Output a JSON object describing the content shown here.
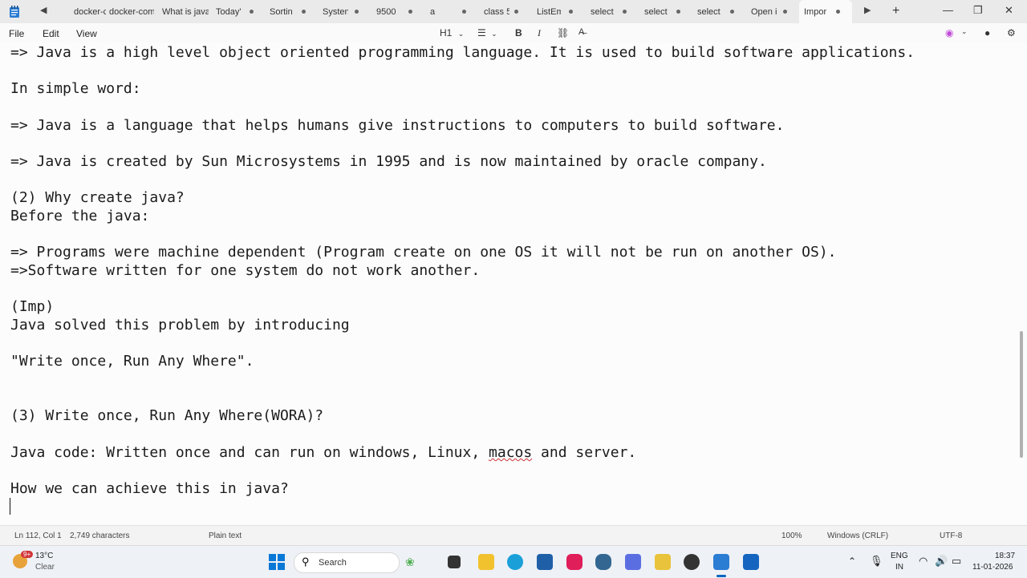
{
  "tabs": [
    {
      "label": "docker-com"
    },
    {
      "label": "docker-com"
    },
    {
      "label": "What is java"
    },
    {
      "label": "Today'"
    },
    {
      "label": "Sortin"
    },
    {
      "label": "Systen"
    },
    {
      "label": "9500"
    },
    {
      "label": "a"
    },
    {
      "label": "class 5"
    },
    {
      "label": "ListEm"
    },
    {
      "label": "select"
    },
    {
      "label": "select"
    },
    {
      "label": "select"
    },
    {
      "label": "Open i"
    },
    {
      "label": "Impor"
    }
  ],
  "menu": {
    "file": "File",
    "edit": "Edit",
    "view": "View"
  },
  "format": {
    "heading": "H1"
  },
  "editor": {
    "lines": [
      "=> Java is a high level object oriented programming language. It is used to build software applications.",
      "In simple word:",
      "=> Java is a language that helps humans give instructions to computers to build software.",
      "=> Java is created by Sun Microsystems in 1995 and is now maintained by oracle company.",
      "(2) Why create java?",
      "Before the java:",
      "=> Programs were machine dependent (Program create on one OS it will not be run on another OS).",
      "=>Software written for one system do not work another.",
      "(Imp)",
      "Java solved this problem by introducing",
      "\"Write once, Run Any Where\".",
      "(3) Write once, Run Any Where(WORA)?",
      "Java code: Written once and can run on windows, Linux, ",
      "macos",
      " and server.",
      "How we can achieve this in java?"
    ]
  },
  "status": {
    "position": "Ln 112, Col 1",
    "characters": "2,749 characters",
    "format": "Plain text",
    "zoom": "100%",
    "line_ending": "Windows (CRLF)",
    "encoding": "UTF-8"
  },
  "taskbar": {
    "weather_temp": "13°C",
    "weather_desc": "Clear",
    "weather_badge": "9+",
    "search": "Search",
    "lang1": "ENG",
    "lang2": "IN",
    "time": "18:37",
    "date": "11-01-2026"
  },
  "colors": {
    "accent": "#0067c0",
    "active_tab_bg": "#fafafa",
    "taskbar_bg": "#eef1f6"
  }
}
